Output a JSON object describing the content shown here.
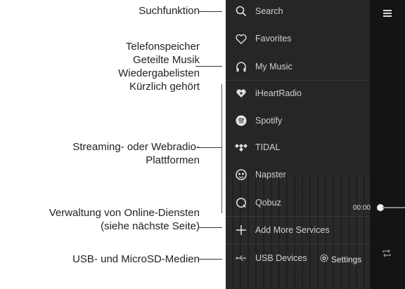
{
  "annotations": {
    "search": "Suchfunktion",
    "music_lines": [
      "Telefonspeicher",
      "Geteilte Musik",
      "Wiedergabelisten",
      "Kürzlich gehört"
    ],
    "streaming_lines": [
      "Streaming- oder Webradio-",
      "Plattformen"
    ],
    "online_lines": [
      "Verwaltung von Online-Diensten",
      "(siehe nächste Seite)"
    ],
    "usb": "USB- und MicroSD-Medien"
  },
  "menu": {
    "items": [
      {
        "label": "Search",
        "icon": "search-icon"
      },
      {
        "label": "Favorites",
        "icon": "heart-icon"
      },
      {
        "label": "My Music",
        "icon": "headphones-icon"
      },
      {
        "label": "iHeartRadio",
        "icon": "iheartradio-icon"
      },
      {
        "label": "Spotify",
        "icon": "spotify-icon"
      },
      {
        "label": "TIDAL",
        "icon": "tidal-icon"
      },
      {
        "label": "Napster",
        "icon": "napster-icon"
      },
      {
        "label": "Qobuz",
        "icon": "qobuz-icon"
      },
      {
        "label": "Add More Services",
        "icon": "plus-icon"
      },
      {
        "label": "USB Devices",
        "icon": "usb-icon"
      }
    ],
    "settings_label": "Settings"
  },
  "player": {
    "time": "00:00"
  }
}
